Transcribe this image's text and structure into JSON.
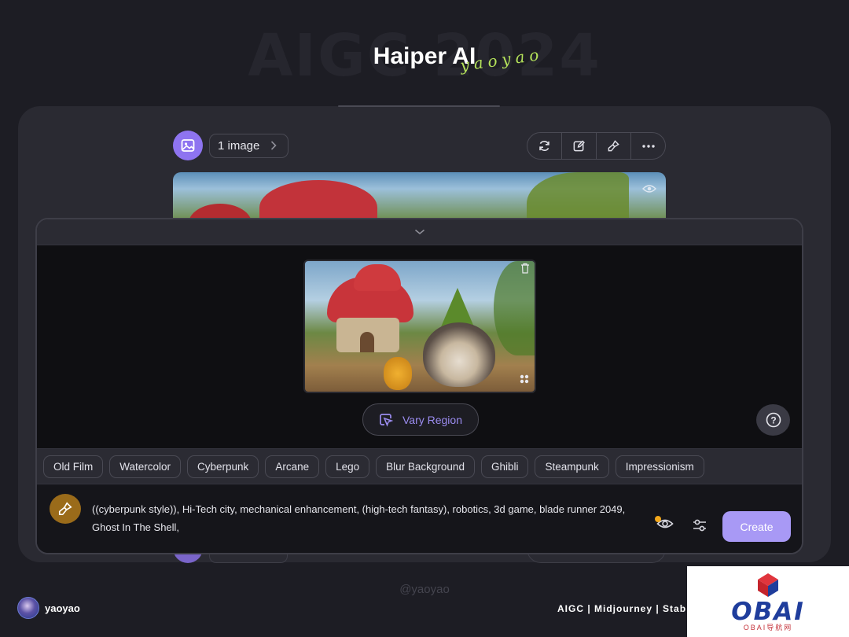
{
  "header": {
    "background_title": "AIGC 2024",
    "title": "Haiper AI",
    "signature": "yaoyao"
  },
  "gallery": {
    "image_count": "1 image",
    "toolbar_icons": [
      "refresh-icon",
      "edit-icon",
      "brush-icon",
      "more-icon"
    ]
  },
  "modal": {
    "vary_region_label": "Vary Region",
    "help_label": "?",
    "styles": [
      "Old Film",
      "Watercolor",
      "Cyberpunk",
      "Arcane",
      "Lego",
      "Blur Background",
      "Ghibli",
      "Steampunk",
      "Impressionism"
    ],
    "prompt_line1": "((cyberpunk style)), Hi-Tech city, mechanical enhancement, (high-tech fantasy), robotics, 3d game, blade runner 2049,",
    "prompt_line2": "Ghost In The Shell,",
    "create_label": "Create"
  },
  "footer": {
    "watermark": "@yaoyao",
    "username": "yaoyao",
    "tags": "AIGC | Midjourney | Stab",
    "logo_text": "OBAI",
    "logo_sub": "OBAI导航网"
  },
  "colors": {
    "accent": "#8e74f0",
    "create": "#a899f5",
    "brush": "#9a6b1a",
    "signature": "#b5e35a"
  }
}
